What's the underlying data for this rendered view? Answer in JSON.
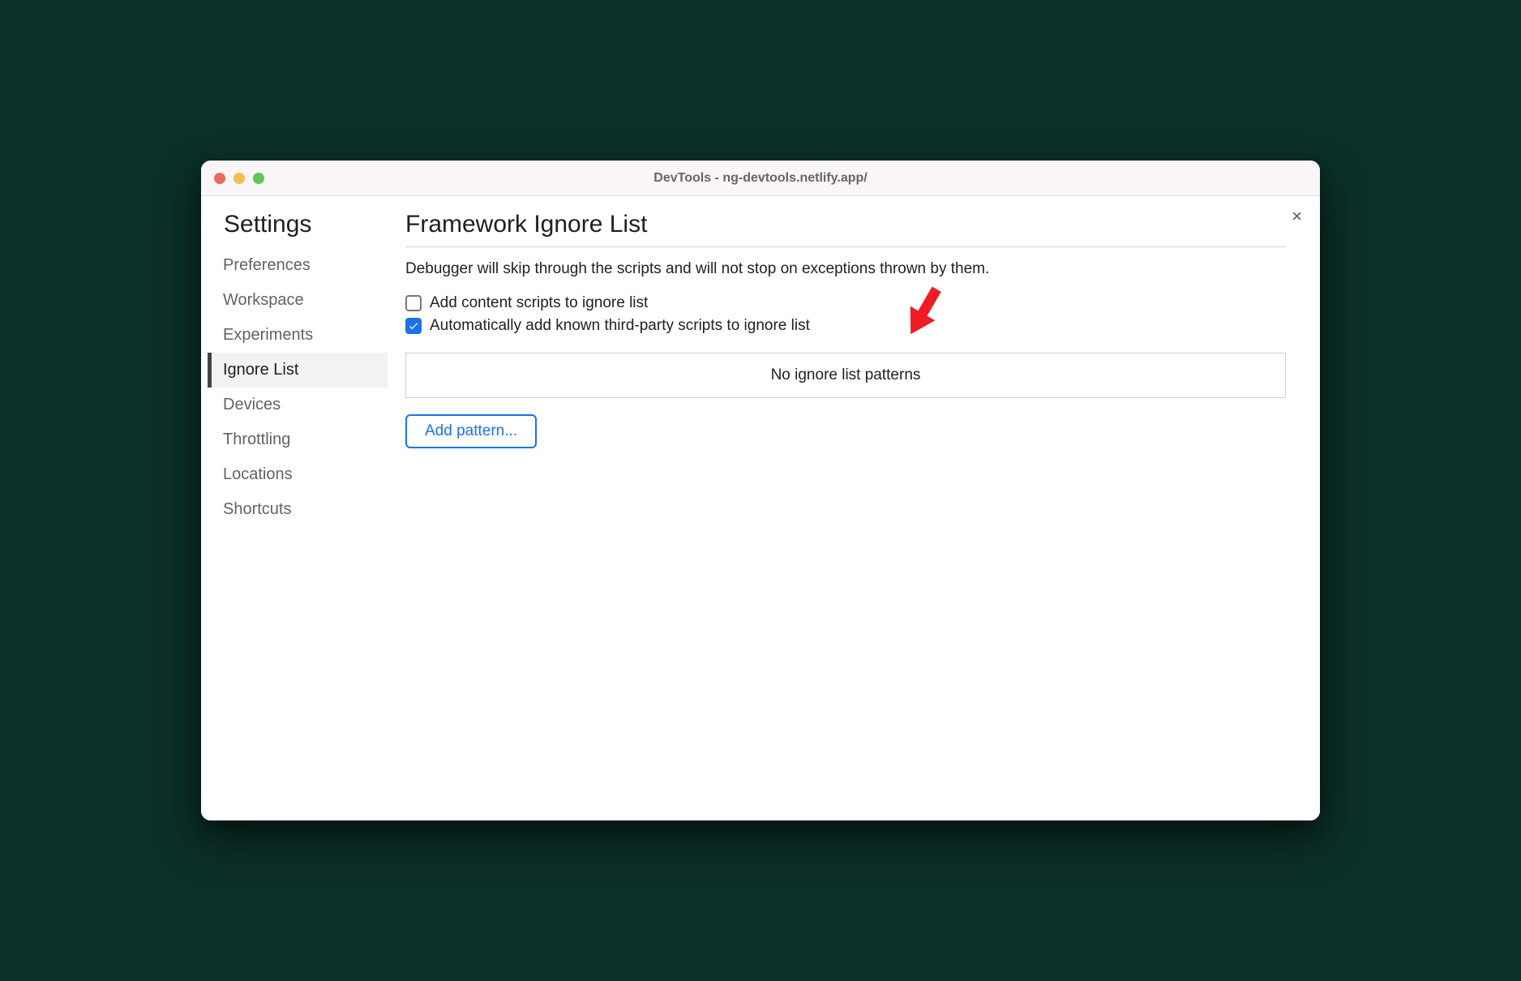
{
  "window": {
    "title": "DevTools - ng-devtools.netlify.app/"
  },
  "close_label": "×",
  "sidebar": {
    "title": "Settings",
    "items": [
      {
        "label": "Preferences",
        "active": false
      },
      {
        "label": "Workspace",
        "active": false
      },
      {
        "label": "Experiments",
        "active": false
      },
      {
        "label": "Ignore List",
        "active": true
      },
      {
        "label": "Devices",
        "active": false
      },
      {
        "label": "Throttling",
        "active": false
      },
      {
        "label": "Locations",
        "active": false
      },
      {
        "label": "Shortcuts",
        "active": false
      }
    ]
  },
  "main": {
    "title": "Framework Ignore List",
    "description": "Debugger will skip through the scripts and will not stop on exceptions thrown by them.",
    "checkboxes": [
      {
        "label": "Add content scripts to ignore list",
        "checked": false
      },
      {
        "label": "Automatically add known third-party scripts to ignore list",
        "checked": true
      }
    ],
    "pattern_box": "No ignore list patterns",
    "add_pattern_button": "Add pattern..."
  },
  "annotation": {
    "color": "#ee1c25"
  }
}
